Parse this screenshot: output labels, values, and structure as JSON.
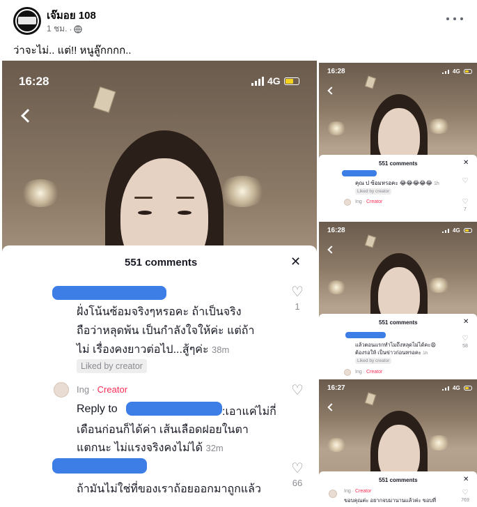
{
  "post": {
    "author": "เจ๊มอย 108",
    "time": "1 ชม.",
    "dot": "·",
    "audience_icon": "globe-icon",
    "caption": "ว่าจะไม่.. แต่!! หนูลู๊กกกก.."
  },
  "main_shot": {
    "time": "16:28",
    "network": "4G",
    "comments_title": "551 comments",
    "close": "✕",
    "comment1_lines": [
      "ฝั่งโน้นซ้อมจริงๆหรอคะ ถ้าเป็นจริง",
      "ถือว่าหลุดพ้น เป็นกำลังใจให้ค่ะ แต่ถ้า",
      "ไม่ เรื่องคงยาวต่อไป...สู้ๆค่ะ"
    ],
    "comment1_time": "38m",
    "comment1_likes": "1",
    "liked_by_creator": "Liked by creator",
    "creator_name": "Ing",
    "creator_sep": "·",
    "creator_tag": "Creator",
    "reply_prefix": "Reply to",
    "reply_line1_tail": ":เอาแค่ไม่กี่",
    "reply_lines": [
      "เดือนก่อนก็ได้ค่า เส้นเลือดฝอยในตา",
      "แตกนะ ไม่แรงจริงคงไม่ได้"
    ],
    "reply_time": "32m",
    "comment3_line": "ถ้ามันไม่ใช่ที่ของเราถ้อยออกมาถูกแล้ว",
    "comment3_likes": "66"
  },
  "shot1": {
    "time": "16:28",
    "network": "4G",
    "comments_title": "551 comments",
    "close": "✕",
    "comment_text": "คุณ ป ซ้อมหรอคะ 😂😂😂😂😂",
    "comment_time": "1h",
    "liked_by_creator": "Liked by creator",
    "creator_name": "Ing",
    "creator_tag": "Creator",
    "like_count": "7"
  },
  "shot2": {
    "time": "16:28",
    "network": "4G",
    "comments_title": "551 comments",
    "close": "✕",
    "comment_lines": [
      "แล้วตอนแรกทำไมถึงหลุดไม่ได้คะ😩",
      "ต้องรอให้ เป็นข่าวก่อนหรอคะ"
    ],
    "comment_time": "1h",
    "liked_by_creator": "Liked by creator",
    "creator_name": "Ing",
    "creator_tag": "Creator",
    "like_count": "58"
  },
  "shot3": {
    "time": "16:27",
    "network": "4G",
    "comments_title": "551 comments",
    "close": "✕",
    "creator_name": "Ing",
    "creator_tag": "Creator",
    "comment_text": "ขอบคุณค่ะ อยากจบมานานแล้วค่ะ ขอบที่",
    "like_count": "769"
  },
  "colors": {
    "redaction": "#3d7de6",
    "creator_tag": "#fe2c55",
    "battery": "#f5d21f"
  }
}
